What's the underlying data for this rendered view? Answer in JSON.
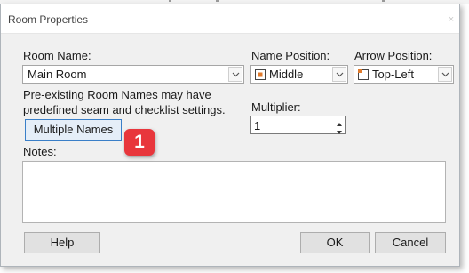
{
  "dialog": {
    "title": "Room Properties",
    "close_glyph": "×"
  },
  "room_name": {
    "label": "Room Name:",
    "value": "Main Room"
  },
  "name_position": {
    "label": "Name Position:",
    "value": "Middle",
    "icon": "middle-position-icon"
  },
  "arrow_position": {
    "label": "Arrow Position:",
    "value": "Top-Left",
    "icon": "top-left-position-icon"
  },
  "info": {
    "line1": "Pre-existing Room Names may have",
    "line2": "predefined seam and checklist settings."
  },
  "multiplier": {
    "label": "Multiplier:",
    "value": "1"
  },
  "buttons": {
    "multiple_names": "Multiple Names",
    "help": "Help",
    "ok": "OK",
    "cancel": "Cancel"
  },
  "notes": {
    "label": "Notes:",
    "value": ""
  },
  "annotation": {
    "number": "1",
    "color": "#e8363c"
  },
  "colors": {
    "focus_border": "#3a7fc8",
    "icon_orange": "#e07a2b"
  }
}
